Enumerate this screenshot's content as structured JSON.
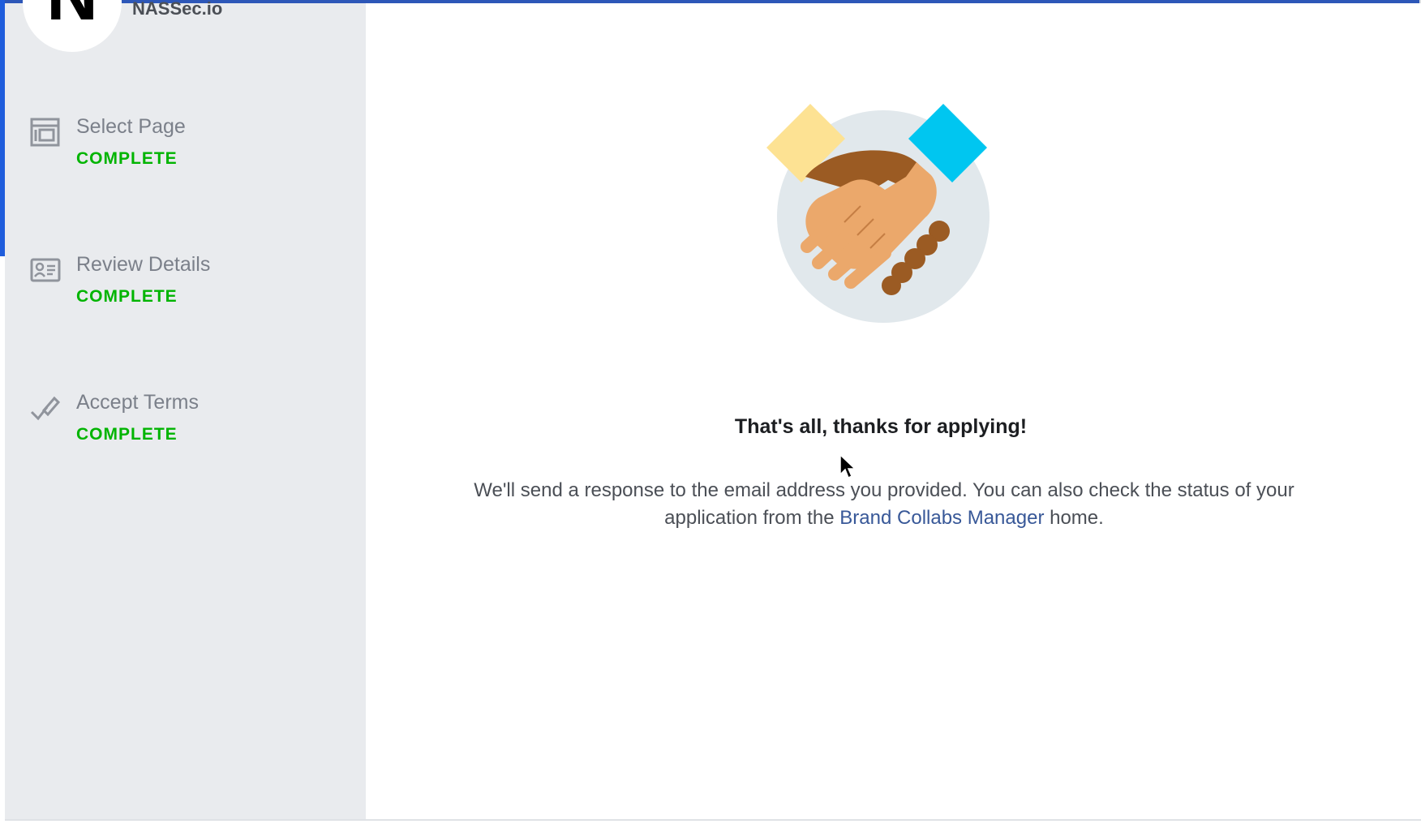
{
  "page": {
    "name": "NASSec.io",
    "avatar_letter": "N"
  },
  "steps": [
    {
      "label": "Select Page",
      "status": "COMPLETE",
      "icon": "page-icon"
    },
    {
      "label": "Review Details",
      "status": "COMPLETE",
      "icon": "id-card-icon"
    },
    {
      "label": "Accept Terms",
      "status": "COMPLETE",
      "icon": "pen-check-icon"
    }
  ],
  "confirmation": {
    "headline": "That's all, thanks for applying!",
    "body_before": "We'll send a response to the email address you provided. You can also check the status of your application from the ",
    "link": "Brand Collabs Manager",
    "body_after": " home."
  },
  "colors": {
    "accent": "#1f5ddc",
    "complete": "#00b400",
    "link": "#385898",
    "sidebar_bg": "#e9ebee"
  }
}
